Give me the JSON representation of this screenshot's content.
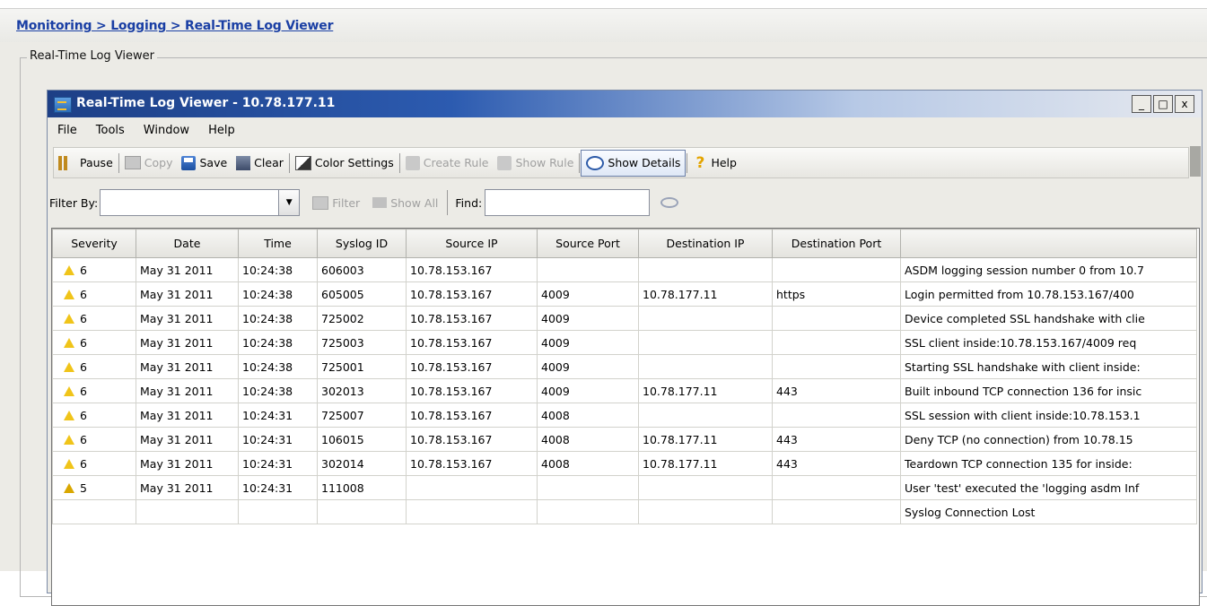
{
  "breadcrumb": "Monitoring > Logging > Real-Time Log Viewer",
  "group_title": "Real-Time Log Viewer",
  "window": {
    "title": "Real-Time Log Viewer - 10.78.177.11",
    "controls": {
      "minimize": "_",
      "maximize": "□",
      "close": "x"
    }
  },
  "menu": [
    "File",
    "Tools",
    "Window",
    "Help"
  ],
  "toolbar": {
    "pause": "Pause",
    "copy": "Copy",
    "save": "Save",
    "clear": "Clear",
    "color_settings": "Color Settings",
    "create_rule": "Create Rule",
    "show_rule": "Show Rule",
    "show_details": "Show Details",
    "help": "Help"
  },
  "filterbar": {
    "filter_by_label": "Filter By:",
    "filter_value": "",
    "filter_button": "Filter",
    "show_all_button": "Show All",
    "find_label": "Find:",
    "find_value": ""
  },
  "table": {
    "columns": [
      "Severity",
      "Date",
      "Time",
      "Syslog ID",
      "Source IP",
      "Source Port",
      "Destination IP",
      "Destination Port",
      ""
    ],
    "rows": [
      [
        "6",
        "May 31 2011",
        "10:24:38",
        "606003",
        "10.78.153.167",
        "",
        "",
        "",
        "ASDM logging session number 0 from 10.7"
      ],
      [
        "6",
        "May 31 2011",
        "10:24:38",
        "605005",
        "10.78.153.167",
        "4009",
        "10.78.177.11",
        "https",
        "Login permitted from 10.78.153.167/400"
      ],
      [
        "6",
        "May 31 2011",
        "10:24:38",
        "725002",
        "10.78.153.167",
        "4009",
        "",
        "",
        "Device completed SSL handshake with clie"
      ],
      [
        "6",
        "May 31 2011",
        "10:24:38",
        "725003",
        "10.78.153.167",
        "4009",
        "",
        "",
        "SSL client inside:10.78.153.167/4009 req"
      ],
      [
        "6",
        "May 31 2011",
        "10:24:38",
        "725001",
        "10.78.153.167",
        "4009",
        "",
        "",
        "Starting SSL handshake with client inside:"
      ],
      [
        "6",
        "May 31 2011",
        "10:24:38",
        "302013",
        "10.78.153.167",
        "4009",
        "10.78.177.11",
        "443",
        "Built inbound TCP connection 136 for insic"
      ],
      [
        "6",
        "May 31 2011",
        "10:24:31",
        "725007",
        "10.78.153.167",
        "4008",
        "",
        "",
        "SSL session with client inside:10.78.153.1"
      ],
      [
        "6",
        "May 31 2011",
        "10:24:31",
        "106015",
        "10.78.153.167",
        "4008",
        "10.78.177.11",
        "443",
        "Deny TCP (no connection) from 10.78.15"
      ],
      [
        "6",
        "May 31 2011",
        "10:24:31",
        "302014",
        "10.78.153.167",
        "4008",
        "10.78.177.11",
        "443",
        "Teardown TCP connection 135 for inside:"
      ],
      [
        "5",
        "May 31 2011",
        "10:24:31",
        "111008",
        "",
        "",
        "",
        "",
        "User 'test' executed the 'logging asdm Inf"
      ],
      [
        "",
        "",
        "",
        "",
        "",
        "",
        "",
        "",
        "Syslog Connection Lost"
      ]
    ]
  }
}
